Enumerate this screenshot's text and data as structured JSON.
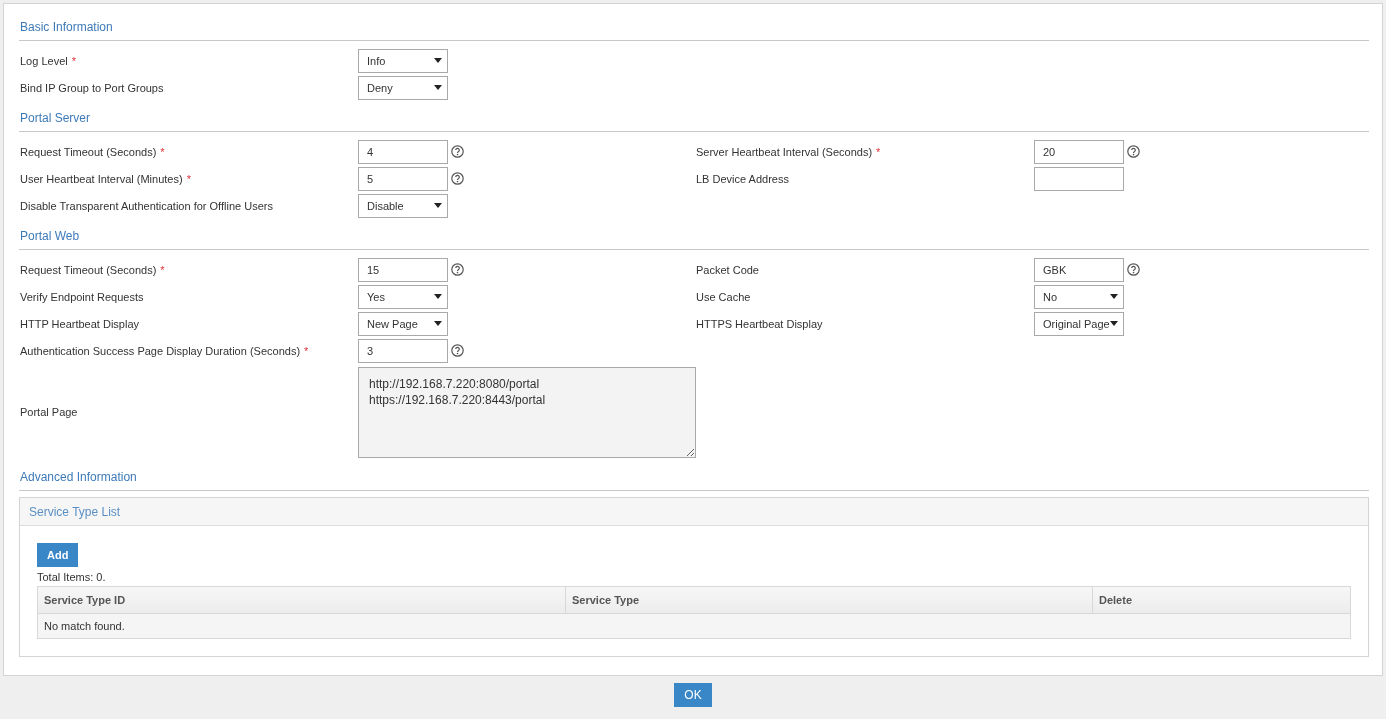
{
  "sections": [
    {
      "title": "Basic Information",
      "rows": [
        [
          {
            "label": "Log Level",
            "required": true,
            "kind": "select",
            "value": "Info"
          }
        ],
        [
          {
            "label": "Bind IP Group to Port Groups",
            "kind": "select",
            "value": "Deny"
          }
        ]
      ]
    },
    {
      "title": "Portal Server",
      "rows": [
        [
          {
            "label": "Request Timeout (Seconds)",
            "required": true,
            "kind": "input",
            "value": "4",
            "help": true
          },
          {
            "label": "Server Heartbeat Interval (Seconds)",
            "required": true,
            "kind": "input",
            "value": "20",
            "help": true
          }
        ],
        [
          {
            "label": "User Heartbeat Interval (Minutes)",
            "required": true,
            "kind": "input",
            "value": "5",
            "help": true
          },
          {
            "label": "LB Device Address",
            "kind": "input"
          }
        ],
        [
          {
            "label": "Disable Transparent Authentication for Offline Users",
            "kind": "select",
            "value": "Disable"
          }
        ]
      ]
    },
    {
      "title": "Portal Web",
      "rows": [
        [
          {
            "label": "Request Timeout (Seconds)",
            "required": true,
            "kind": "input",
            "value": "15",
            "help": true
          },
          {
            "label": "Packet Code",
            "kind": "input",
            "value": "GBK",
            "help": true
          }
        ],
        [
          {
            "label": "Verify Endpoint Requests",
            "kind": "select",
            "value": "Yes"
          },
          {
            "label": "Use Cache",
            "kind": "select",
            "value": "No"
          }
        ],
        [
          {
            "label": "HTTP Heartbeat Display",
            "kind": "select",
            "value": "New Page"
          },
          {
            "label": "HTTPS Heartbeat Display",
            "kind": "select",
            "value": "Original Page"
          }
        ],
        [
          {
            "label": "Authentication Success Page Display Duration (Seconds)",
            "required": true,
            "kind": "input",
            "value": "3",
            "help": true
          }
        ],
        [
          {
            "label": "Portal Page",
            "kind": "textarea",
            "value": "http://192.168.7.220:8080/portal\nhttps://192.168.7.220:8443/portal"
          }
        ]
      ]
    },
    {
      "title": "Advanced Information"
    }
  ],
  "required_mark": "*",
  "panel": {
    "title": "Service Type List",
    "add_button": "Add",
    "total": "Total Items: 0.",
    "columns": [
      "Service Type ID",
      "Service Type",
      "Delete"
    ],
    "empty_text": "No match found."
  },
  "ok_button": "OK"
}
